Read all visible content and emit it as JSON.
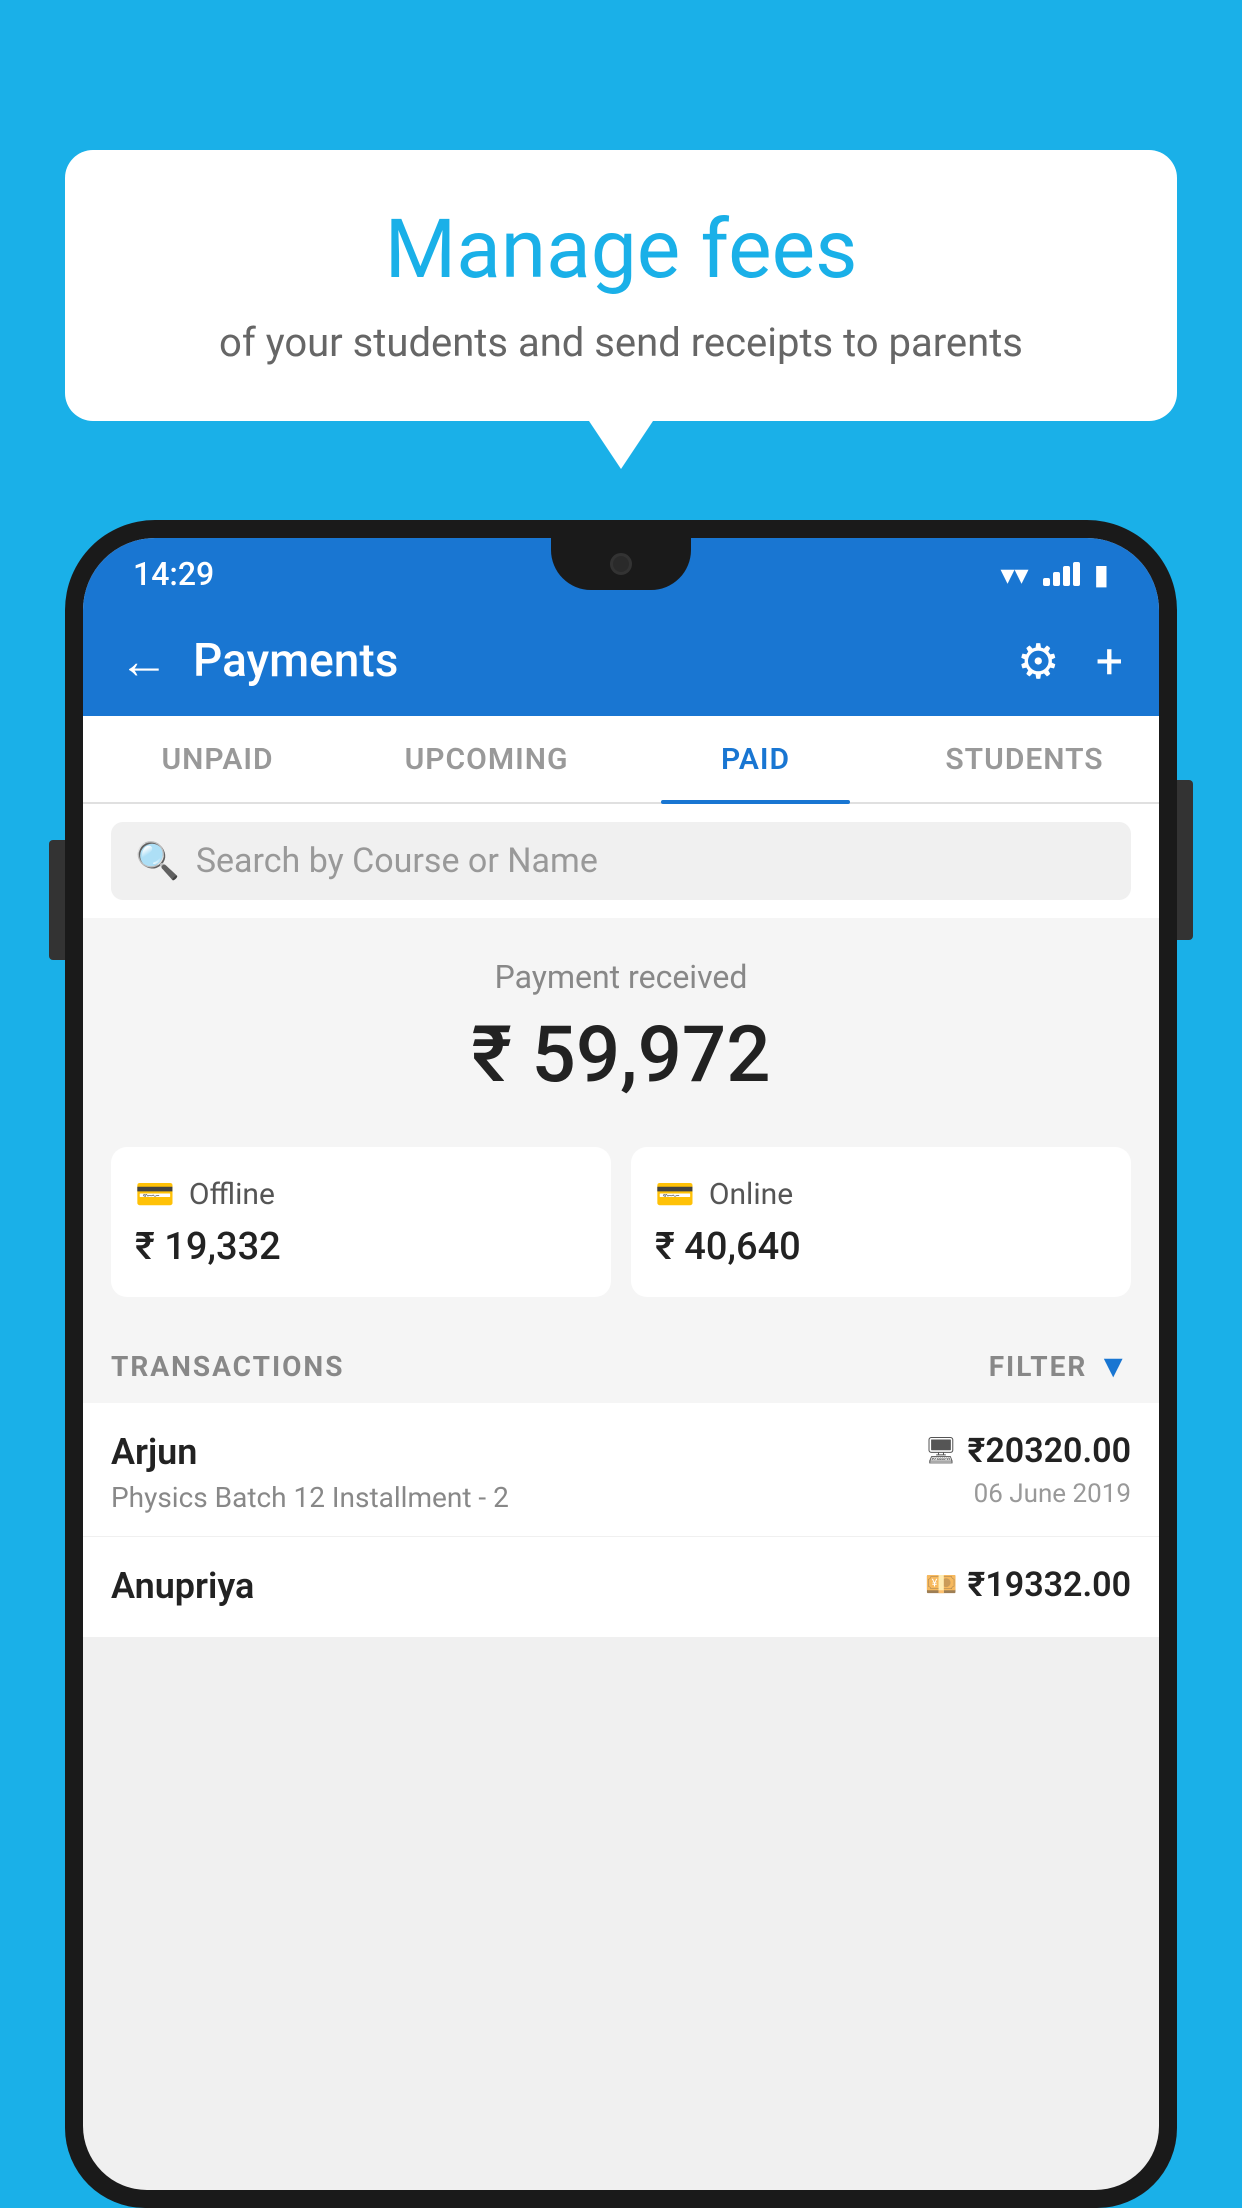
{
  "background_color": "#1ab0e8",
  "bubble": {
    "title": "Manage fees",
    "subtitle": "of your students and send receipts to parents"
  },
  "status_bar": {
    "time": "14:29"
  },
  "app_bar": {
    "title": "Payments",
    "back_icon": "←",
    "gear_icon": "⚙",
    "plus_icon": "+"
  },
  "tabs": [
    {
      "label": "UNPAID",
      "active": false
    },
    {
      "label": "UPCOMING",
      "active": false
    },
    {
      "label": "PAID",
      "active": true
    },
    {
      "label": "STUDENTS",
      "active": false
    }
  ],
  "search": {
    "placeholder": "Search by Course or Name"
  },
  "payment_summary": {
    "label": "Payment received",
    "amount": "₹ 59,972",
    "offline": {
      "label": "Offline",
      "amount": "₹ 19,332"
    },
    "online": {
      "label": "Online",
      "amount": "₹ 40,640"
    }
  },
  "transactions": {
    "header": "TRANSACTIONS",
    "filter_label": "FILTER",
    "items": [
      {
        "name": "Arjun",
        "description": "Physics Batch 12 Installment - 2",
        "amount": "₹20320.00",
        "type": "online",
        "date": "06 June 2019"
      },
      {
        "name": "Anupriya",
        "description": "",
        "amount": "₹19332.00",
        "type": "offline",
        "date": ""
      }
    ]
  }
}
